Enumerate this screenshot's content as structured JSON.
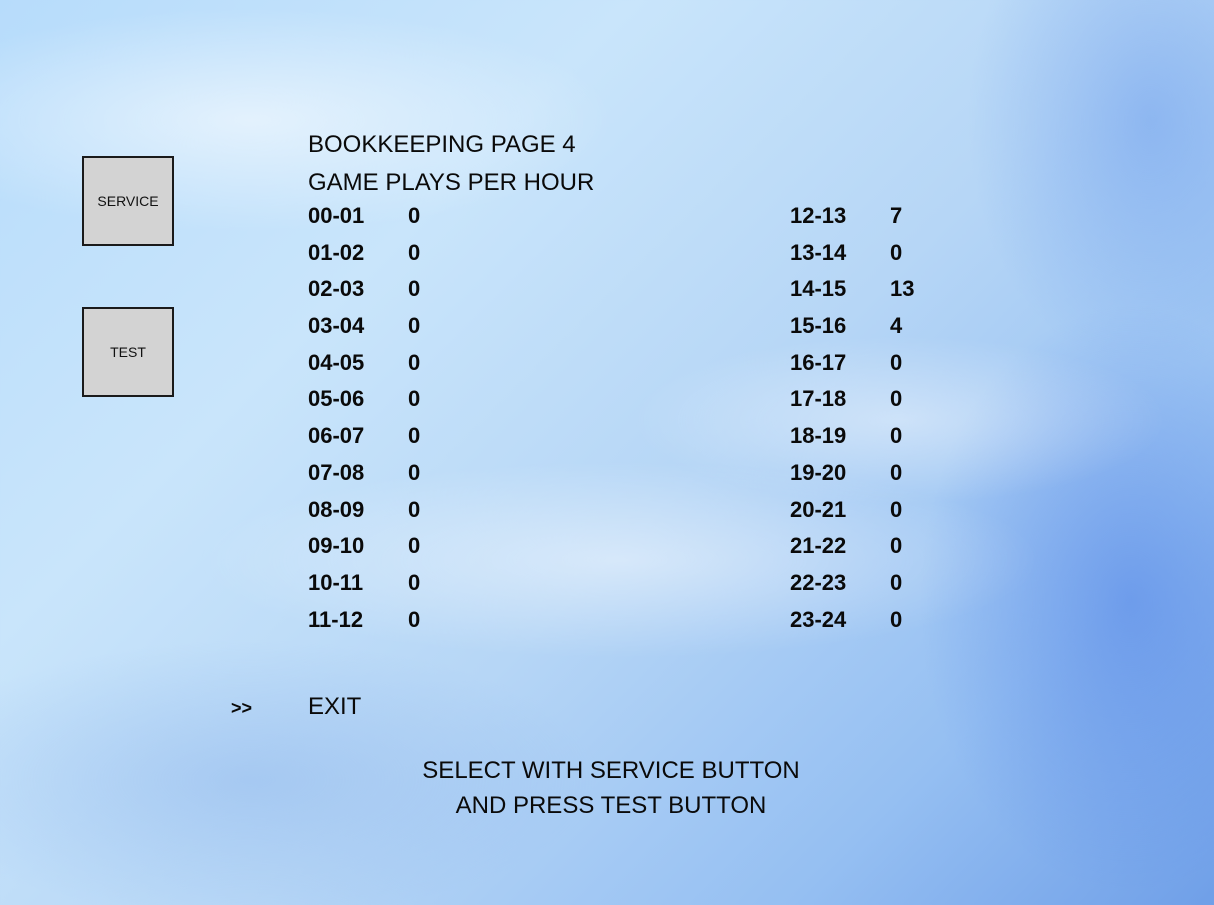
{
  "buttons": {
    "service": "SERVICE",
    "test": "TEST"
  },
  "page": {
    "title": "BOOKKEEPING PAGE 4",
    "subtitle": "GAME PLAYS PER HOUR"
  },
  "hours_left": [
    {
      "range": "00-01",
      "count": "0"
    },
    {
      "range": "01-02",
      "count": "0"
    },
    {
      "range": "02-03",
      "count": "0"
    },
    {
      "range": "03-04",
      "count": "0"
    },
    {
      "range": "04-05",
      "count": "0"
    },
    {
      "range": "05-06",
      "count": "0"
    },
    {
      "range": "06-07",
      "count": "0"
    },
    {
      "range": "07-08",
      "count": "0"
    },
    {
      "range": "08-09",
      "count": "0"
    },
    {
      "range": "09-10",
      "count": "0"
    },
    {
      "range": "10-11",
      "count": "0"
    },
    {
      "range": "11-12",
      "count": "0"
    }
  ],
  "hours_right": [
    {
      "range": "12-13",
      "count": "7"
    },
    {
      "range": "13-14",
      "count": "0"
    },
    {
      "range": "14-15",
      "count": "13"
    },
    {
      "range": "15-16",
      "count": "4"
    },
    {
      "range": "16-17",
      "count": "0"
    },
    {
      "range": "17-18",
      "count": "0"
    },
    {
      "range": "18-19",
      "count": "0"
    },
    {
      "range": "19-20",
      "count": "0"
    },
    {
      "range": "20-21",
      "count": "0"
    },
    {
      "range": "21-22",
      "count": "0"
    },
    {
      "range": "22-23",
      "count": "0"
    },
    {
      "range": "23-24",
      "count": "0"
    }
  ],
  "menu": {
    "cursor": ">>",
    "exit_label": "EXIT"
  },
  "instructions": {
    "line1": "SELECT WITH SERVICE BUTTON",
    "line2": "AND PRESS TEST BUTTON"
  }
}
